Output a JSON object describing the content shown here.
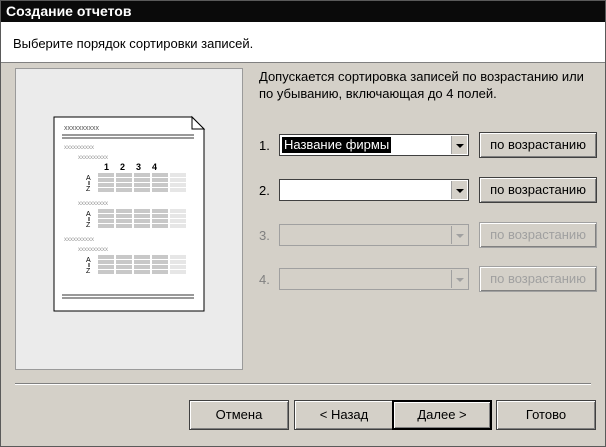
{
  "window": {
    "title": "Создание отчетов"
  },
  "header": {
    "text": "Выберите порядок сортировки записей."
  },
  "description": "Допускается сортировка записей по возрастанию или по убыванию, включающая до 4 полей.",
  "preview": {
    "header_text": "xxxxxxxxxx",
    "group1": "xxxxxxxxxx",
    "group2": "xxxxxxxxxx",
    "column_numbers": [
      "1",
      "2",
      "3",
      "4"
    ],
    "sort_glyph_top": "A",
    "sort_glyph_bottom": "Z"
  },
  "sort_rows": [
    {
      "number": "1.",
      "value": "Название фирмы",
      "order": "по возрастанию",
      "enabled": true
    },
    {
      "number": "2.",
      "value": "",
      "order": "по возрастанию",
      "enabled": true
    },
    {
      "number": "3.",
      "value": "",
      "order": "по возрастанию",
      "enabled": false
    },
    {
      "number": "4.",
      "value": "",
      "order": "по возрастанию",
      "enabled": false
    }
  ],
  "buttons": {
    "cancel": "Отмена",
    "back": "< Назад",
    "next": "Далее >",
    "finish": "Готово"
  }
}
